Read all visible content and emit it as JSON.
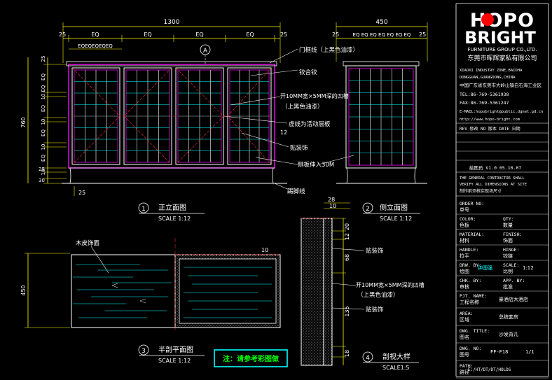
{
  "colors": {
    "background": "#000000",
    "frame": "#ffffff",
    "dimension": "#ffff00",
    "cabinet": "#ff00ff",
    "glass": "#00ffff",
    "hatch": "#ff3333",
    "note_box": "#00ffff",
    "note_text": "#00ff00"
  },
  "front_elevation": {
    "overall_width": "1300",
    "edge_left": "25",
    "edge_right": "25",
    "equal_labels": [
      "EQ",
      "EQ",
      "EQ",
      "EQ"
    ],
    "small_eq": "EQEQEQEQEQ",
    "height": "760",
    "left_dims": [
      "25",
      "EQ",
      "10 EQ",
      "EQ",
      "10",
      "EQ",
      "10",
      "EQ",
      "10",
      "25",
      "30"
    ],
    "bottom_dim": "25",
    "section_marker": "A",
    "title_number": "1",
    "title": "正立面图",
    "scale": "SCALE 1:12"
  },
  "side_elevation": {
    "overall_width": "450",
    "edge_left": "25",
    "edge_right": "25",
    "eq_labels": "EQ EQ EQ EQ EQ EQ EQ",
    "title_number": "2",
    "title": "侧立面图",
    "scale": "SCALE 1:12"
  },
  "callouts": {
    "door_edge": "门框线（上黑色油漆）",
    "hinge": "铰合铰",
    "glass": "开10MM宽×5MM深的凹槽",
    "glass_sub": "（上黑色油漆）",
    "shelf": "虚线为活动层板",
    "shelf_num": "12",
    "veneer": "贴装饰",
    "bottom_panel": "侧板伸入30M",
    "plinth": "踢脚线"
  },
  "half_plan": {
    "label": "木皮饰面",
    "height": "450",
    "dim": "10",
    "title_number": "3",
    "title": "半剖平面图",
    "scale": "SCALE 1:12"
  },
  "section_detail": {
    "top_dims": [
      "28",
      "10"
    ],
    "vertical_dims": [
      "20",
      "12",
      "68",
      "135",
      "18"
    ],
    "label_veneer": "贴装饰",
    "label_groove": "开10MM宽×5MM深的凹槽",
    "label_groove_sub": "（上黑色油漆）",
    "label_veneer2": "贴装饰",
    "title_number": "4",
    "title": "剖视大样",
    "scale": "SCALE1:5"
  },
  "note": "注：请参考彩图做",
  "title_block": {
    "logo_top": "HOPO",
    "logo_bottom": "BRIGHT",
    "company_en": "FURNITURE GROUP CO.,LTD.",
    "company_cn": "东莞市晖辉家私有限公司",
    "addr1": "XIAOXI INDUSTRY ZONE,BAIDHA",
    "addr2": "DONGGUAN,GUANGDONG,CHINA",
    "addr3": "中国广东省东莞市大岭山镇白石海工业区",
    "tel": "TEL:86-769-5361938",
    "fax": "FAX:86-769-5361247",
    "email": "E-MAIL:hopobright@public.dgnet.gd.cn",
    "web": "http://www.hopo-bright.com",
    "rev_row": "REV  修改    NO 版本   DATE 日期",
    "draw_row": "绘图员    V1.0    05.10.07",
    "notes1": "THE GENERAL CONTRACTOR SHALL",
    "notes2": "VERIFY ALL DIMENSIONS AT SITE",
    "notes3": "制作前须核实现场尺寸",
    "fields": [
      {
        "en": "ORDER NO:",
        "cn": "单号"
      },
      {
        "en": "COLOR:",
        "cn": "色板",
        "en2": "QTY:",
        "cn2": "数量"
      },
      {
        "en": "MATERIAL:",
        "cn": "材料",
        "en2": "FINISH:",
        "cn2": "饰面"
      },
      {
        "en": "HANDLE:",
        "cn": "拉手",
        "en2": "HINGE:",
        "cn2": "铰链"
      },
      {
        "en": "DRW. BY:",
        "cn": "绘图",
        "en2": "SCALE:",
        "cn2": "比例"
      },
      {
        "en": "CHK. BY:",
        "cn": "审核",
        "en2": "APP. BY:",
        "cn2": "批准"
      },
      {
        "en": "PJT. NAME:",
        "cn": "工程名称"
      },
      {
        "en": "AREA:",
        "cn": "区域"
      },
      {
        "en": "DWG. TITLE:",
        "cn": "图名"
      },
      {
        "en": "DWG. NO:",
        "cn": "图号"
      },
      {
        "en": "PATH:",
        "cn": "路径"
      }
    ],
    "drw_value": "钟国强",
    "scale_value": "1:12",
    "project_value": "豪酒店大酒店",
    "area_value": "总统套房",
    "title_value": "沙发背几",
    "dwg_no_value": "FF-F18",
    "sheet_value": "1/1",
    "path_value": "E:/HT/DT/DT/HOLDS"
  }
}
